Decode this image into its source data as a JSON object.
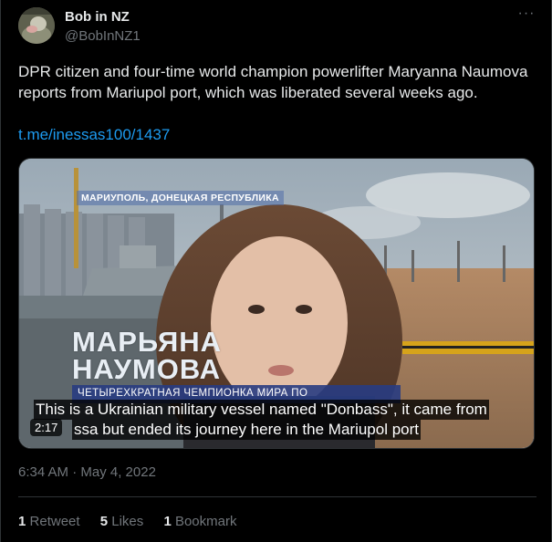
{
  "author": {
    "name": "Bob in NZ",
    "handle": "@BobInNZ1"
  },
  "more_icon": "more-horizontal-icon",
  "tweet": {
    "text": "DPR citizen and four-time world champion powerlifter Maryanna Naumova reports from Mariupol port, which was liberated several weeks ago.",
    "link": "t.me/inessas100/1437"
  },
  "media": {
    "location_label": "МАРИУПОЛЬ, ДОНЕЦКАЯ РЕСПУБЛИКА",
    "name_line1": "МАРЬЯНА",
    "name_line2": "НАУМОВА",
    "title_ribbon": "ЧЕТЫРЕХКРАТНАЯ ЧЕМПИОНКА МИРА ПО",
    "subtitle_line1": "This is a Ukrainian military vessel named \"Donbass\", it came from",
    "subtitle_line2": "ssa but ended its journey here in the Mariupol port",
    "duration": "2:17"
  },
  "timestamp": "6:34 AM · May 4, 2022",
  "stats": {
    "retweets_count": "1",
    "retweets_label": "Retweet",
    "likes_count": "5",
    "likes_label": "Likes",
    "bookmarks_count": "1",
    "bookmarks_label": "Bookmark"
  }
}
